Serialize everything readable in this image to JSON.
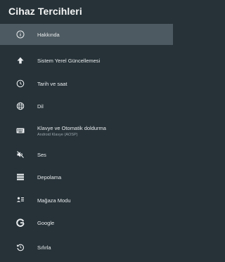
{
  "panel": {
    "title": "Cihaz Tercihleri"
  },
  "menu": {
    "items": [
      {
        "label": "Hakkında",
        "icon": "info-icon",
        "selected": true
      },
      {
        "label": "Sistem Yerel Güncellemesi",
        "icon": "arrow-up-icon"
      },
      {
        "label": "Tarih ve saat",
        "icon": "clock-icon"
      },
      {
        "label": "Dil",
        "icon": "globe-icon"
      },
      {
        "label": "Klavye ve Otomatik doldurma",
        "sublabel": "Android Klavye (AOSP)",
        "icon": "keyboard-icon"
      },
      {
        "label": "Ses",
        "icon": "sound-off-icon"
      },
      {
        "label": "Depolama",
        "icon": "storage-icon"
      },
      {
        "label": "Mağaza Modu",
        "icon": "store-mode-icon"
      },
      {
        "label": "Google",
        "icon": "google-icon"
      },
      {
        "label": "Sıfırla",
        "icon": "reset-icon"
      }
    ]
  },
  "colors": {
    "background": "#263238",
    "selected": "#4d5a61",
    "text": "#e9ecee",
    "subtext": "#9aa6ac"
  }
}
